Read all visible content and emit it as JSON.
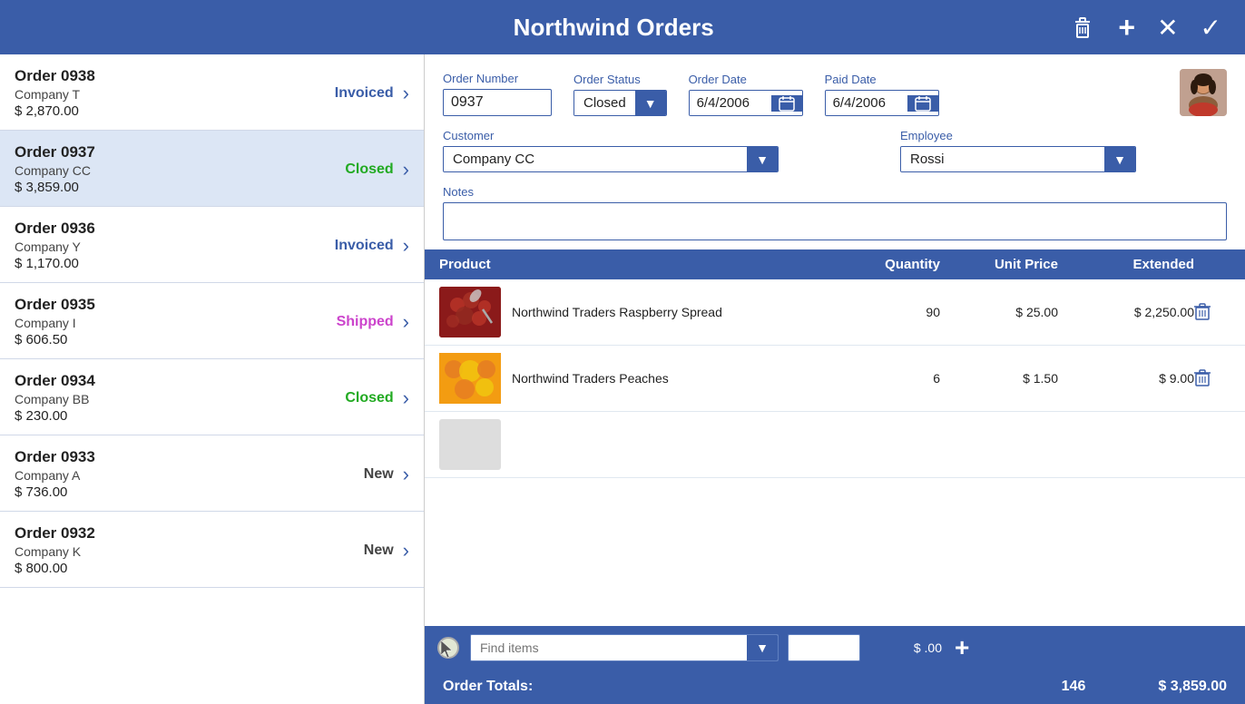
{
  "app": {
    "title": "Northwind Orders"
  },
  "header": {
    "delete_label": "🗑",
    "add_label": "+",
    "cancel_label": "✕",
    "confirm_label": "✓"
  },
  "orders": [
    {
      "id": "0938",
      "company": "Company T",
      "amount": "$ 2,870.00",
      "status": "Invoiced",
      "status_class": "status-invoiced"
    },
    {
      "id": "0937",
      "company": "Company CC",
      "amount": "$ 3,859.00",
      "status": "Closed",
      "status_class": "status-closed",
      "selected": true
    },
    {
      "id": "0936",
      "company": "Company Y",
      "amount": "$ 1,170.00",
      "status": "Invoiced",
      "status_class": "status-invoiced"
    },
    {
      "id": "0935",
      "company": "Company I",
      "amount": "$ 606.50",
      "status": "Shipped",
      "status_class": "status-shipped"
    },
    {
      "id": "0934",
      "company": "Company BB",
      "amount": "$ 230.00",
      "status": "Closed",
      "status_class": "status-closed"
    },
    {
      "id": "0933",
      "company": "Company A",
      "amount": "$ 736.00",
      "status": "New",
      "status_class": "status-new"
    },
    {
      "id": "0932",
      "company": "Company K",
      "amount": "$ 800.00",
      "status": "New",
      "status_class": "status-new"
    }
  ],
  "detail": {
    "order_number_label": "Order Number",
    "order_number_value": "0937",
    "order_status_label": "Order Status",
    "order_status_value": "Closed",
    "order_date_label": "Order Date",
    "order_date_value": "6/4/2006",
    "paid_date_label": "Paid Date",
    "paid_date_value": "6/4/2006",
    "customer_label": "Customer",
    "customer_value": "Company CC",
    "employee_label": "Employee",
    "employee_value": "Rossi",
    "notes_label": "Notes",
    "notes_value": ""
  },
  "table": {
    "col_product": "Product",
    "col_quantity": "Quantity",
    "col_unit_price": "Unit Price",
    "col_extended": "Extended"
  },
  "products": [
    {
      "name": "Northwind Traders Raspberry Spread",
      "quantity": "90",
      "unit_price": "$ 25.00",
      "extended": "$ 2,250.00",
      "img_type": "raspberry"
    },
    {
      "name": "Northwind Traders Peaches",
      "quantity": "6",
      "unit_price": "$ 1.50",
      "extended": "$ 9.00",
      "img_type": "peaches"
    },
    {
      "name": "",
      "quantity": "",
      "unit_price": "",
      "extended": "",
      "img_type": "blank"
    }
  ],
  "add_item": {
    "find_placeholder": "Find items",
    "qty_value": "",
    "price_display": "$ .00",
    "add_label": "+"
  },
  "totals": {
    "label": "Order Totals:",
    "quantity": "146",
    "amount": "$ 3,859.00"
  }
}
